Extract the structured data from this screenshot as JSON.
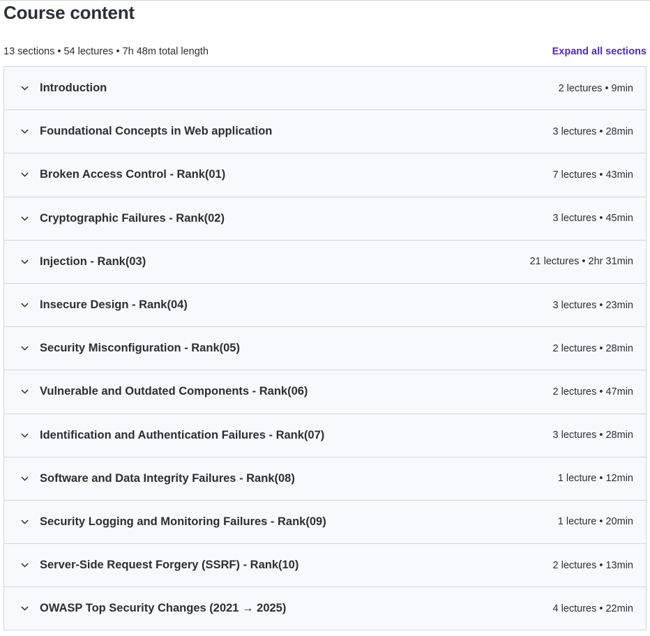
{
  "header": {
    "title": "Course content",
    "summary": "13 sections • 54 lectures • 7h 48m total length",
    "expand_label": "Expand all sections"
  },
  "colors": {
    "accent": "#5624d0",
    "section_bg": "#f7f9fa",
    "border": "#d1d7dc",
    "text": "#2d2f31"
  },
  "sections": [
    {
      "title": "Introduction",
      "meta": "2 lectures • 9min"
    },
    {
      "title": "Foundational Concepts in Web application",
      "meta": "3 lectures • 28min"
    },
    {
      "title": "Broken Access Control - Rank(01)",
      "meta": "7 lectures • 43min"
    },
    {
      "title": "Cryptographic Failures - Rank(02)",
      "meta": "3 lectures • 45min"
    },
    {
      "title": "Injection - Rank(03)",
      "meta": "21 lectures • 2hr 31min"
    },
    {
      "title": "Insecure Design - Rank(04)",
      "meta": "3 lectures • 23min"
    },
    {
      "title": "Security Misconfiguration - Rank(05)",
      "meta": "2 lectures • 28min"
    },
    {
      "title": "Vulnerable and Outdated Components - Rank(06)",
      "meta": "2 lectures • 47min"
    },
    {
      "title": "Identification and Authentication Failures - Rank(07)",
      "meta": "3 lectures • 28min"
    },
    {
      "title": "Software and Data Integrity Failures - Rank(08)",
      "meta": "1 lecture • 12min"
    },
    {
      "title": "Security Logging and Monitoring Failures - Rank(09)",
      "meta": "1 lecture • 20min"
    },
    {
      "title": "Server-Side Request Forgery (SSRF) - Rank(10)",
      "meta": "2 lectures • 13min"
    },
    {
      "title": "OWASP Top Security Changes (2021 → 2025)",
      "meta": "4 lectures • 22min"
    }
  ],
  "icons": {
    "section_toggle": "chevron-down-icon"
  }
}
